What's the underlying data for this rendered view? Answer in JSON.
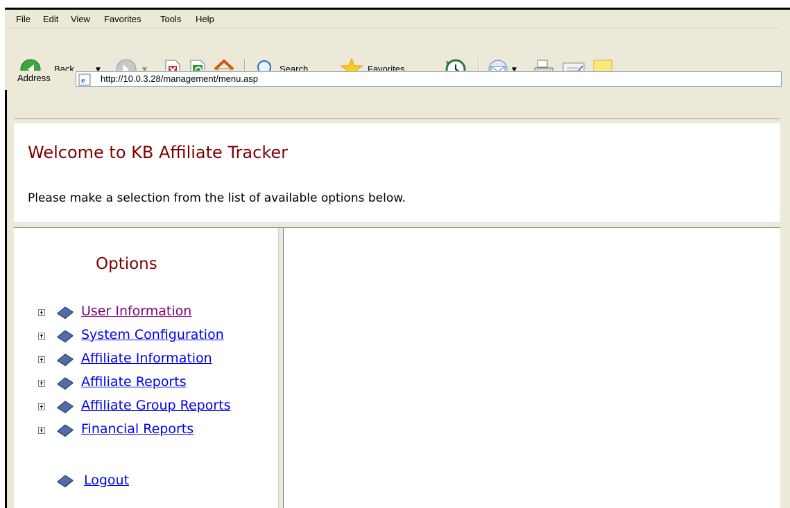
{
  "menu": {
    "file": "File",
    "edit": "Edit",
    "view": "View",
    "favorites": "Favorites",
    "tools": "Tools",
    "help": "Help"
  },
  "toolbar": {
    "back_label": "Back",
    "search_label": "Search",
    "favorites_label": "Favorites"
  },
  "address": {
    "label": "Address",
    "url": "http://10.0.3.28/management/menu.asp"
  },
  "header": {
    "title": "Welcome to KB Affiliate Tracker",
    "instructions": "Please make a selection from the list of available options below."
  },
  "sidebar": {
    "title": "Options",
    "items": [
      {
        "label": "User Information",
        "visited": true
      },
      {
        "label": "System Configuration",
        "visited": false
      },
      {
        "label": "Affiliate Information",
        "visited": false
      },
      {
        "label": "Affiliate Reports",
        "visited": false
      },
      {
        "label": "Affiliate Group Reports",
        "visited": false
      },
      {
        "label": "Financial Reports",
        "visited": false
      }
    ],
    "logout_label": "Logout"
  },
  "colors": {
    "heading": "#800000",
    "link": "#0000ee",
    "visited_link": "#800080"
  }
}
